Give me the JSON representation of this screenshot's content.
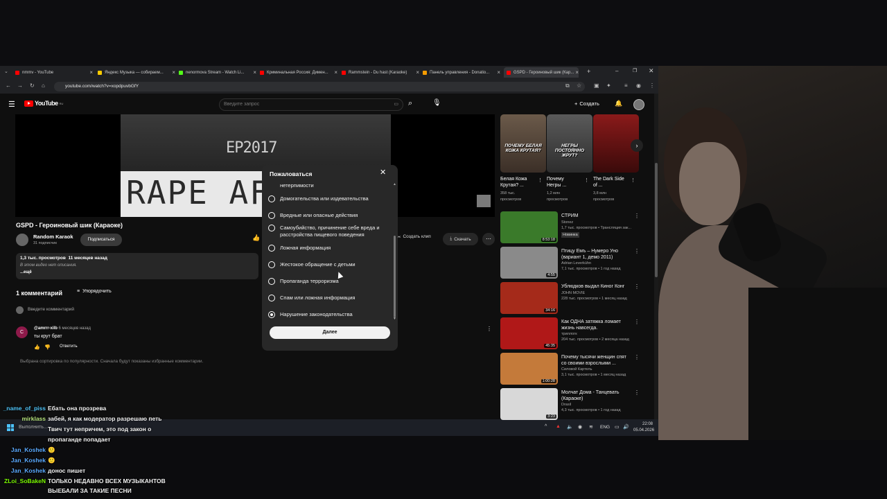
{
  "browser": {
    "tabs": [
      {
        "label": "nmmv - YouTube",
        "color": "#ff0000"
      },
      {
        "label": "Яндекс Музыка — собираем...",
        "color": "#ffcc00"
      },
      {
        "label": "nenormova Stream - Watch Li...",
        "color": "#53fc18"
      },
      {
        "label": "Криминальная Россия: Димен...",
        "color": "#ff0000"
      },
      {
        "label": "Rammstein - Du hast (Karaoke)",
        "color": "#ff0000"
      },
      {
        "label": "Панель управления - Donatio...",
        "color": "#f59b00"
      },
      {
        "label": "GSPD - Героиновый шик (Кар...",
        "color": "#ff0000"
      }
    ],
    "url": "youtube.com/watch?v=xopdpuvbGfY"
  },
  "youtube": {
    "logo": "YouTube",
    "logo_sup": "RU",
    "search_placeholder": "Введите запрос",
    "create_label": "Создать",
    "video_overlay_top": "EP2017",
    "video_overlay_bottom": "RAPE AFT",
    "video_title": "GSPD - Героиновый шик (Караоке)",
    "channel_name": "Random Karaok",
    "subscribers": "31 подписчик",
    "subscribe_label": "Подписаться",
    "clip_label": "Создать клип",
    "download_label": "Скачать",
    "views": "1,3 тыс. просмотров",
    "uploaded": "11 месяцев назад",
    "no_description": "В этом видео нет описания.",
    "more_label": "...ещё",
    "comments_count": "1 комментарий",
    "sort_label": "Упорядочить",
    "comment_placeholder": "Введите комментарий",
    "comment": {
      "avatar_letter": "С",
      "author": "@amrrr-xilb",
      "time": "6 месяцев назад",
      "text": "ты крут брат",
      "reply_label": "Ответить"
    },
    "sort_note": "Выбрана сортировка по популярности. Сначала будут показаны избранные комментарии."
  },
  "report_modal": {
    "title": "Пожаловаться",
    "options": [
      {
        "label": "нетерпимости",
        "selected": false
      },
      {
        "label": "Домогательства или издевательства",
        "selected": false
      },
      {
        "label": "Вредные или опасные действия",
        "selected": false
      },
      {
        "label": "Самоубийство, причинение себе вреда и",
        "label2": "расстройства пищевого поведения",
        "selected": false
      },
      {
        "label": "Ложная информация",
        "selected": false
      },
      {
        "label": "Жестокое обращение с детьми",
        "selected": false
      },
      {
        "label": "Пропаганда терроризма",
        "selected": false
      },
      {
        "label": "Спам или ложная информация",
        "selected": false
      },
      {
        "label": "Нарушение законодательства",
        "selected": true
      }
    ],
    "next_label": "Далее"
  },
  "shorts": [
    {
      "title": "Белая Кожа Крутая? ...",
      "views": "358 тыс.",
      "views2": "просмотров",
      "caption": "ПОЧЕМУ БЕЛАЯ КОЖА КРУТАЯ?"
    },
    {
      "title": "Почему Негры ...",
      "views": "1,2 млн",
      "views2": "просмотров",
      "caption": "НЕГРЫ ПОСТОЯННО ЖРУТ?"
    },
    {
      "title": "The Dark Side of ...",
      "views": "3,8 млн",
      "views2": "просмотров",
      "caption": ""
    }
  ],
  "related": [
    {
      "title": "СТРИМ",
      "title2": "",
      "channel": "Stonez",
      "meta": "1,7 тыс. просмотров • Трансляция зак...",
      "badge": "Новинка",
      "duration": "8:53:18",
      "color": "#3a7a2a"
    },
    {
      "title": "Птицу Емъ – Нумеро Уно",
      "title2": "(вариант 1, демо 2011)",
      "channel": "Adrian Leverkühn",
      "meta": "7,1 тыс. просмотров • 1 год назад",
      "badge": "",
      "duration": "4:55",
      "color": "#8a8a8a"
    },
    {
      "title": "Ублюдков выдал Киног Конг",
      "title2": "",
      "channel": "JOHN MOVIE",
      "meta": "228 тыс. просмотров • 1 месяц назад",
      "badge": "",
      "duration": "34:16",
      "color": "#a52a1a"
    },
    {
      "title": "Как ОДНА затяжка ломает",
      "title2": "жизнь навсегда.",
      "channel": "триллогк",
      "meta": "204 тыс. просмотров • 2 месяца назад",
      "badge": "",
      "duration": "45:35",
      "color": "#b01818"
    },
    {
      "title": "Почему тысячи женщин спят",
      "title2": "со своими взрослыми ...",
      "channel": "Силовой Картель",
      "meta": "3,1 тыс. просмотров • 1 месяц назад",
      "badge": "",
      "duration": "1:00:28",
      "color": "#c47a3a"
    },
    {
      "title": "Молчат Дома - Танцевать",
      "title2": "(Караоке)",
      "channel": "Drasil",
      "meta": "4,3 тыс. просмотров • 1 год назад",
      "badge": "",
      "duration": "3:23",
      "color": "#d8d8d8"
    }
  ],
  "taskbar": {
    "lang": "ENG",
    "time": "22:08",
    "date": "05.04.2026",
    "search_text": "Выполнить..."
  },
  "chat": [
    {
      "name": "_name_of_piss",
      "color": "#4fc3f7",
      "msg": "Ебать она прозрева"
    },
    {
      "name": "mirklass",
      "color": "#b4e07a",
      "msg": "забей, я как модератор разрешаю петь"
    },
    {
      "name": "",
      "color": "#ffffff",
      "msg": "Твич тут непричем, это под закон о"
    },
    {
      "name": "",
      "color": "#ffffff",
      "msg": "пропаганде попадает"
    },
    {
      "name": "Jan_Koshek",
      "color": "#5aa9ff",
      "msg": "🙂"
    },
    {
      "name": "Jan_Koshek",
      "color": "#5aa9ff",
      "msg": "🙂"
    },
    {
      "name": "Jan_Koshek",
      "color": "#5aa9ff",
      "msg": "донос пишет"
    },
    {
      "name": "ZLoi_SoBakeN",
      "color": "#7cfc00",
      "msg": "ТОЛЬКО НЕДАВНО ВСЕХ МУЗЫКАНТОВ"
    },
    {
      "name": "",
      "color": "#ffffff",
      "msg": "ВЫЕБАЛИ ЗА ТАКИЕ ПЕСНИ"
    }
  ]
}
